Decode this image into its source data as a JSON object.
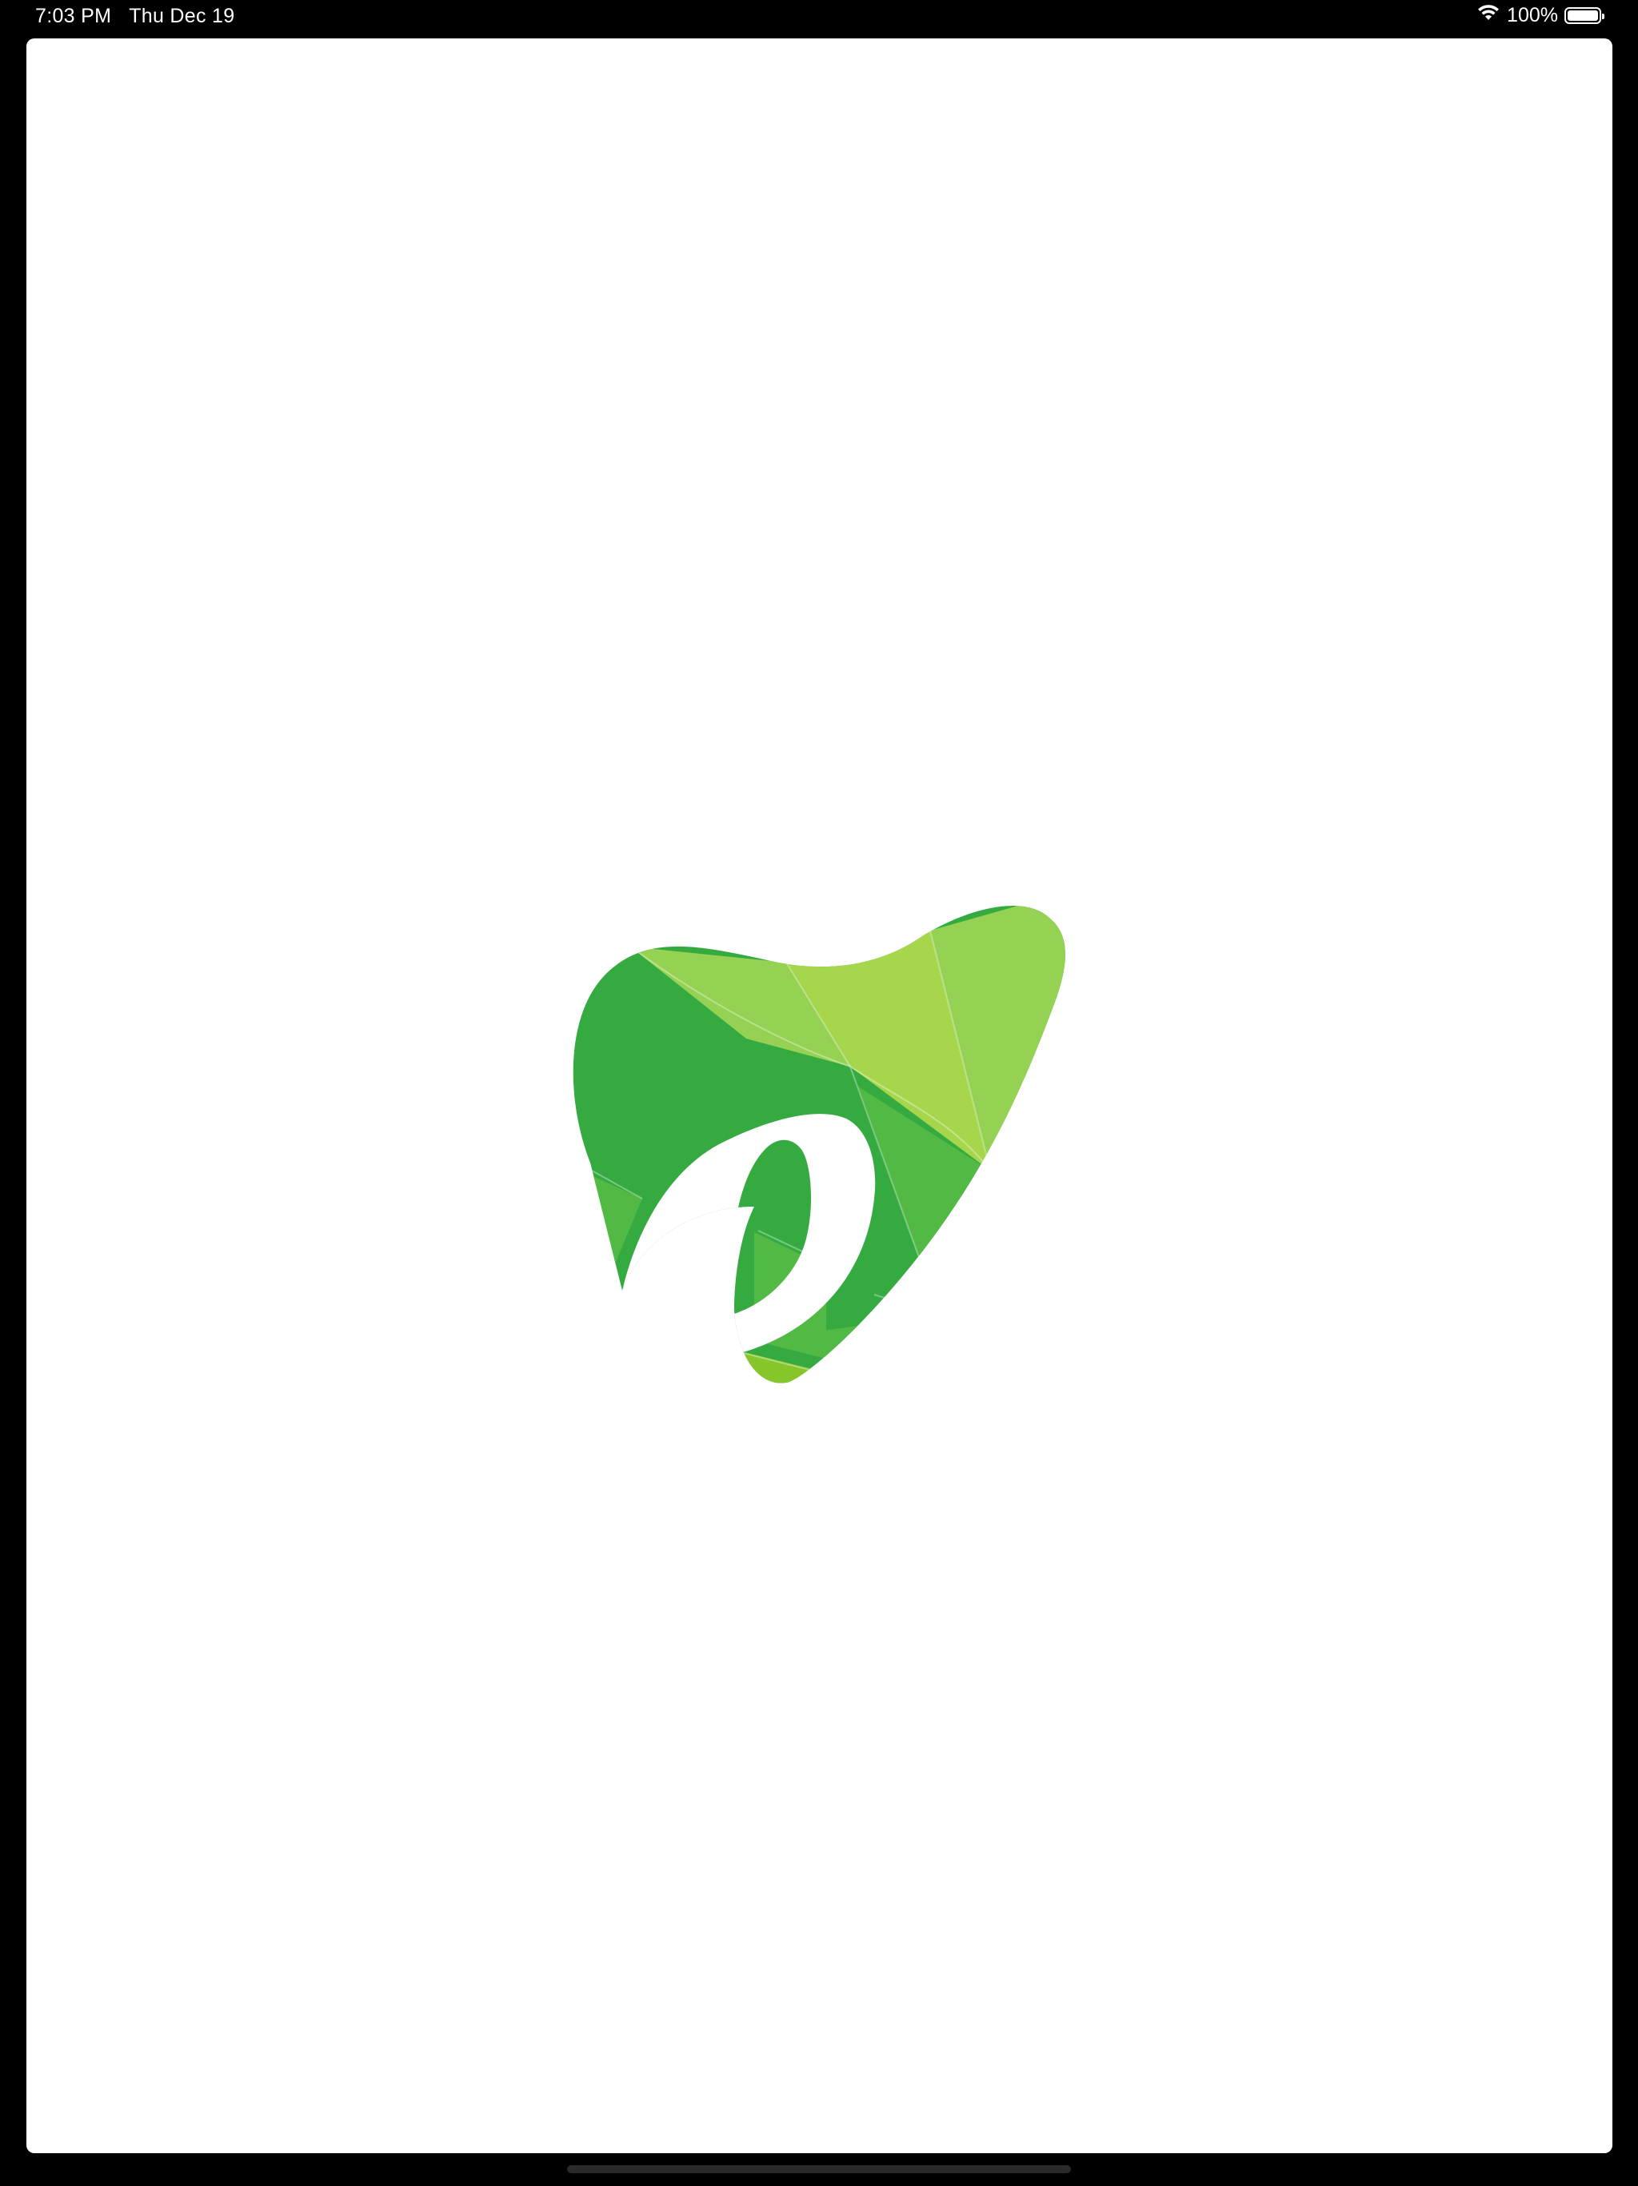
{
  "status_bar": {
    "time": "7:03 PM",
    "date": "Thu Dec 19",
    "battery_percent": "100%",
    "battery_level": 1.0,
    "wifi_icon": "wifi-icon",
    "battery_icon": "battery-icon"
  },
  "splash": {
    "logo_icon": "dental-tooth-logo",
    "colors": {
      "dark_green": "#34AA41",
      "mid_green": "#51B944",
      "light_green": "#95D152",
      "yellow_green": "#A6D64B",
      "lime": "#86C62A",
      "background": "#FFFFFF"
    }
  }
}
